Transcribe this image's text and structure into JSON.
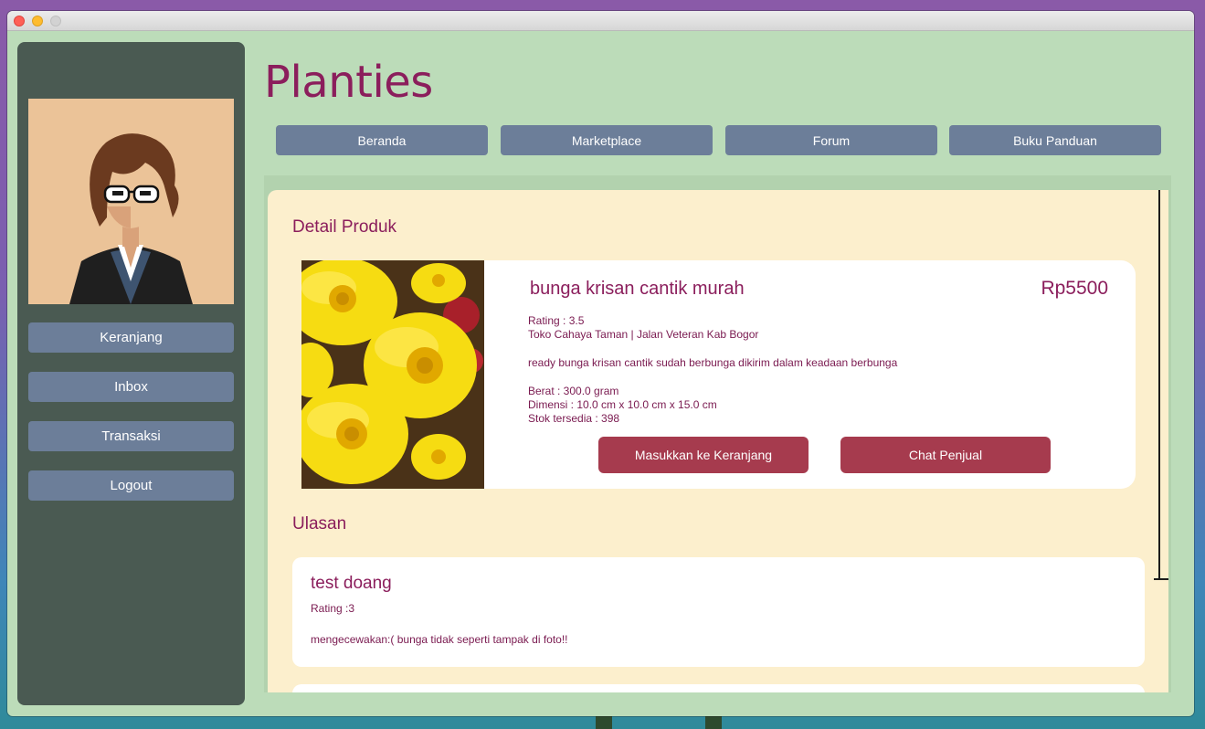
{
  "app": {
    "title": "Planties"
  },
  "sidebar": {
    "items": [
      {
        "label": "Keranjang"
      },
      {
        "label": "Inbox"
      },
      {
        "label": "Transaksi"
      },
      {
        "label": "Logout"
      }
    ]
  },
  "nav": {
    "tabs": [
      {
        "label": "Beranda"
      },
      {
        "label": "Marketplace"
      },
      {
        "label": "Forum"
      },
      {
        "label": "Buku Panduan"
      }
    ]
  },
  "product_section": {
    "title": "Detail Produk",
    "name": "bunga krisan cantik murah",
    "price": "Rp5500",
    "rating": "Rating : 3.5",
    "store": "Toko Cahaya Taman | Jalan Veteran Kab Bogor",
    "description": "ready bunga krisan cantik sudah berbunga dikirim dalam keadaan berbunga",
    "weight": "Berat : 300.0 gram",
    "dimension": "Dimensi : 10.0 cm x 10.0 cm x 15.0 cm",
    "stock": "Stok tersedia : 398",
    "add_to_cart_label": "Masukkan ke Keranjang",
    "chat_seller_label": "Chat Penjual"
  },
  "reviews_section": {
    "title": "Ulasan",
    "reviews": [
      {
        "title": "test doang",
        "rating": "Rating :3",
        "text": "mengecewakan:( bunga tidak seperti tampak di foto!!"
      }
    ]
  },
  "colors": {
    "accent": "#8b1e5c",
    "button": "#6c7e99",
    "action_button": "#a63b4e",
    "window_bg": "#bcdcb9",
    "sidebar_bg": "#4a5a52",
    "content_bg": "#fcefcd"
  }
}
